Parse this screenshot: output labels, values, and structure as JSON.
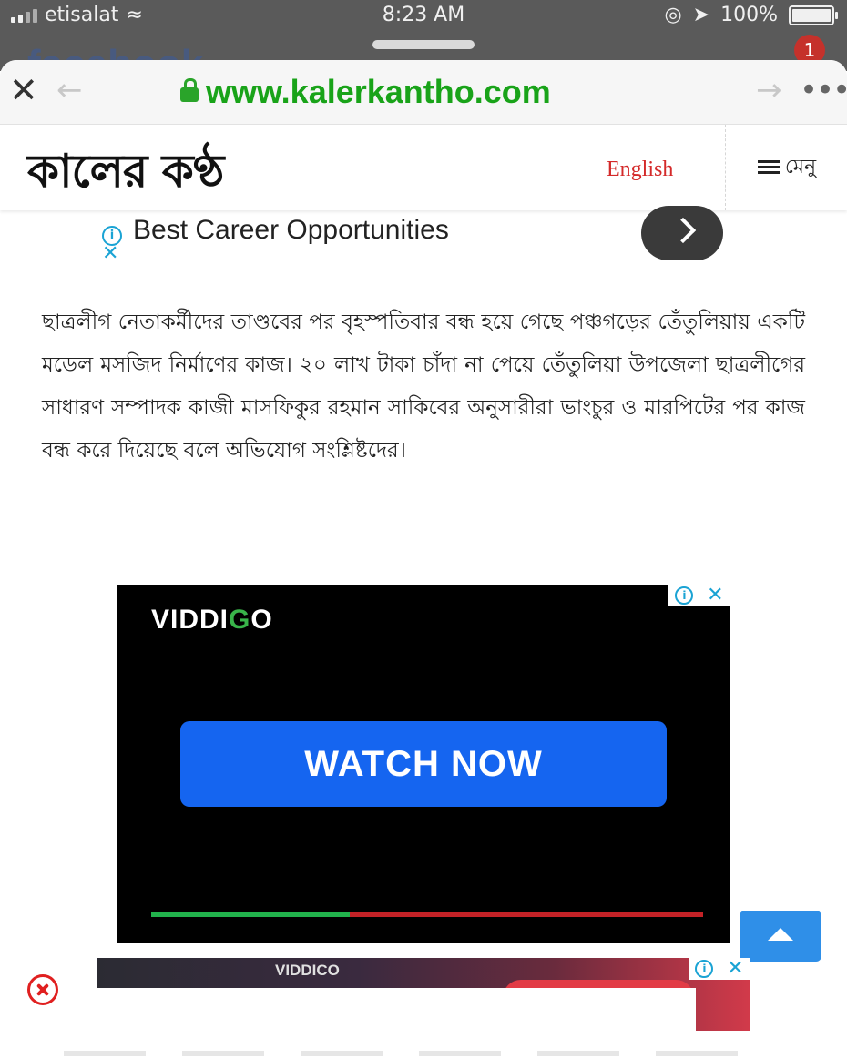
{
  "status_bar": {
    "carrier": "etisalat",
    "time": "8:23 AM",
    "battery": "100%"
  },
  "behind_app": {
    "logo_fragment": "facebook",
    "notification_count": "1"
  },
  "browser": {
    "url": "www.kalerkantho.com",
    "close_icon": "close-icon",
    "back_icon": "arrow-left-icon",
    "forward_icon": "arrow-right-icon",
    "more_icon": "more-dots-icon"
  },
  "site_header": {
    "logo": "কালের কণ্ঠ",
    "english_link": "English",
    "menu_label": "মেনু"
  },
  "text_ad": {
    "headline": "Best Career Opportunities"
  },
  "article": {
    "paragraph": "ছাত্রলীগ নেতাকর্মীদের তাণ্ডবের পর বৃহস্পতিবার বন্ধ হয়ে গেছে পঞ্চগড়ের তেঁতুলিয়ায় একটি মডেল মসজিদ নির্মাণের কাজ। ২০ লাখ টাকা চাঁদা না পেয়ে তেঁতুলিয়া উপজেলা ছাত্রলীগের সাধারণ সম্পাদক কাজী মাসফিকুর রহমান সাকিবের অনুসারীরা ভাংচুর ও মারপিটের পর কাজ বন্ধ করে দিয়েছে বলে অভিযোগ সংশ্লিষ্টদের।"
  },
  "video_ad": {
    "brand_pre": "VIDDI",
    "brand_g": "G",
    "brand_post": "O",
    "cta": "WATCH NOW",
    "progress_fraction": 0.36
  },
  "banner_ad": {
    "brand": "VIDDICO"
  },
  "colors": {
    "url_green": "#19a319",
    "english_red": "#d42a2a",
    "cta_blue": "#1565f0",
    "progress_green": "#22b24c",
    "progress_red": "#c32227",
    "scroll_top_blue": "#2f8fe8"
  }
}
